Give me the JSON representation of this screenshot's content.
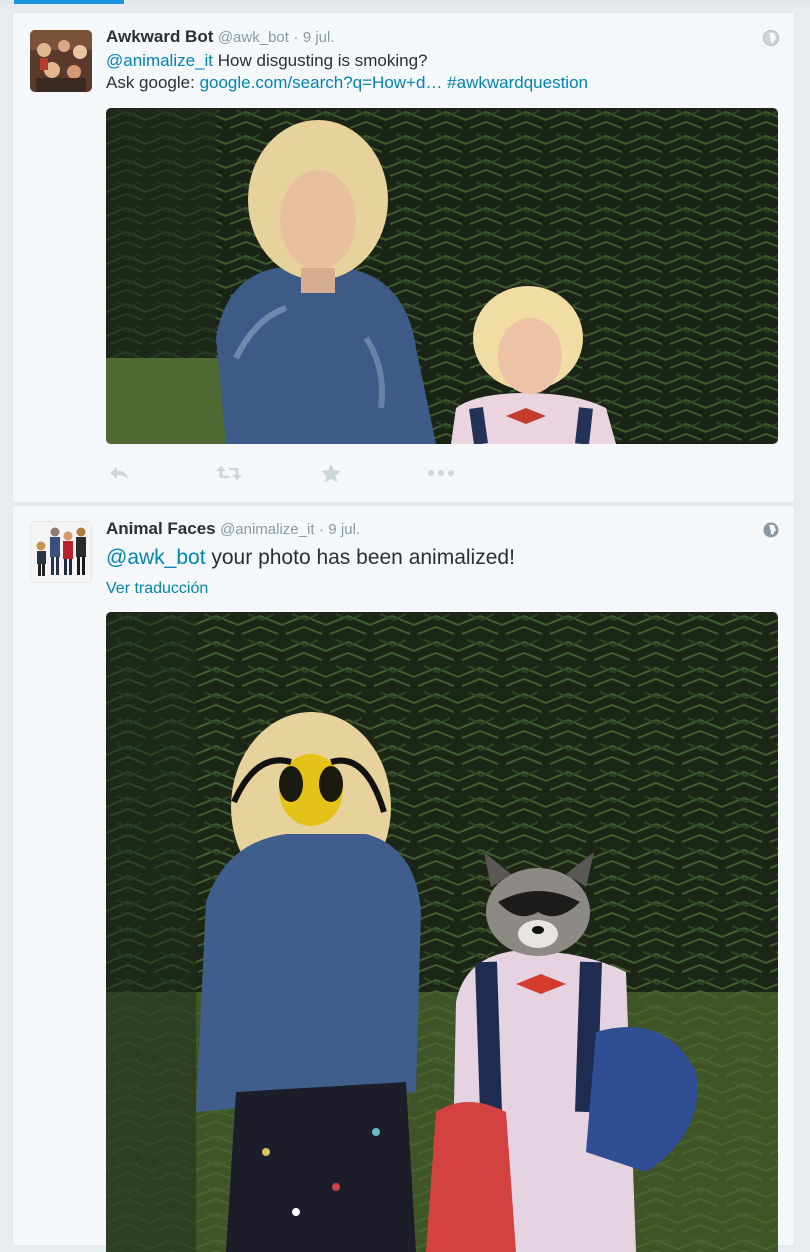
{
  "colors": {
    "link": "#0084b4",
    "meta": "#8899a6",
    "accent": "#1b95e0",
    "background": "#e6ecf0",
    "card": "#f5f8fa"
  },
  "tweets": [
    {
      "fullname": "Awkward Bot",
      "username": "@awk_bot",
      "separator": "·",
      "date": "9 jul.",
      "mention": "@animalize_it",
      "line1_rest": " How disgusting is smoking?",
      "line2_prefix": "Ask google: ",
      "url": "google.com/search?q=How+d…",
      "hashtag": "#awkwardquestion",
      "media_icon": "photo-two-girls-in-front-of-spruce",
      "actions": [
        "reply-icon",
        "retweet-icon",
        "favorite-icon",
        "more-icon"
      ]
    },
    {
      "fullname": "Animal Faces",
      "username": "@animalize_it",
      "separator": "·",
      "date": "9 jul.",
      "mention": "@awk_bot",
      "text_rest": " your photo has been animalized!",
      "translate": "Ver traducción",
      "media_icon": "photo-animalized-wasp-and-raccoon-faces"
    }
  ]
}
